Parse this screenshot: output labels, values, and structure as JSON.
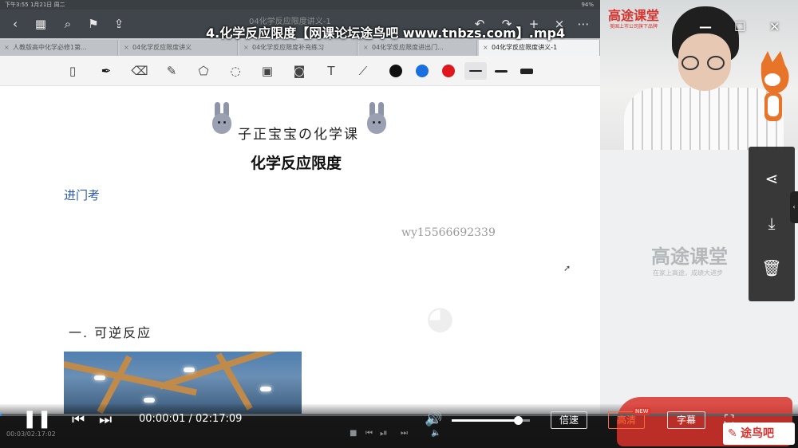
{
  "window": {
    "video_title": "4.化学反应限度【网课论坛途鸟吧 www.tnbzs.com】.mp4"
  },
  "statusbar": {
    "left": "下午3:55  1月21日 周二",
    "right": "94%"
  },
  "appbar": {
    "ghost_title": "04化学反应限度讲义-1"
  },
  "tabs": [
    {
      "label": "人教版高中化学必修1第...",
      "active": false
    },
    {
      "label": "04化学反应限度讲义",
      "active": false
    },
    {
      "label": "04化学反应限度补充练习",
      "active": false
    },
    {
      "label": "04化学反应限度进出门...",
      "active": false
    },
    {
      "label": "04化学反应限度讲义-1",
      "active": true
    }
  ],
  "toolbar": {
    "tools": [
      "pages-icon",
      "pen-icon",
      "eraser-icon",
      "highlighter-icon",
      "lasso-icon",
      "shape-icon",
      "image-icon",
      "camera-icon",
      "text-icon",
      "ruler-icon"
    ],
    "colors": [
      "#111111",
      "#1a6fe0",
      "#e0161c"
    ]
  },
  "document": {
    "course_name": "子正宝宝の化学课",
    "title": "化学反应限度",
    "entry_label": "进门考",
    "watermark": "wy15566692339",
    "section_heading": "一. 可逆反应"
  },
  "webcam": {
    "brand": "高途课堂",
    "brand_sub": "美国上市公司旗下品牌"
  },
  "side": {
    "logo": "高途课堂",
    "logo_sub": "在家上高途，成绩大进步"
  },
  "player": {
    "current_time": "00:00:01",
    "duration": "02:17:09",
    "time_display": "00:00:01 / 02:17:09",
    "progress": 0.0001,
    "volume": 0.85,
    "speed_label": "倍速",
    "quality_label": "高清",
    "quality_badge": "NEW",
    "subtitle_label": "字幕",
    "mini_time": "00:03/02:17:02",
    "corner_logo": "途鸟吧"
  },
  "colors": {
    "accent": "#1e90ff",
    "brand_red": "#d8322c",
    "quality_orange": "#ff6a3a"
  }
}
